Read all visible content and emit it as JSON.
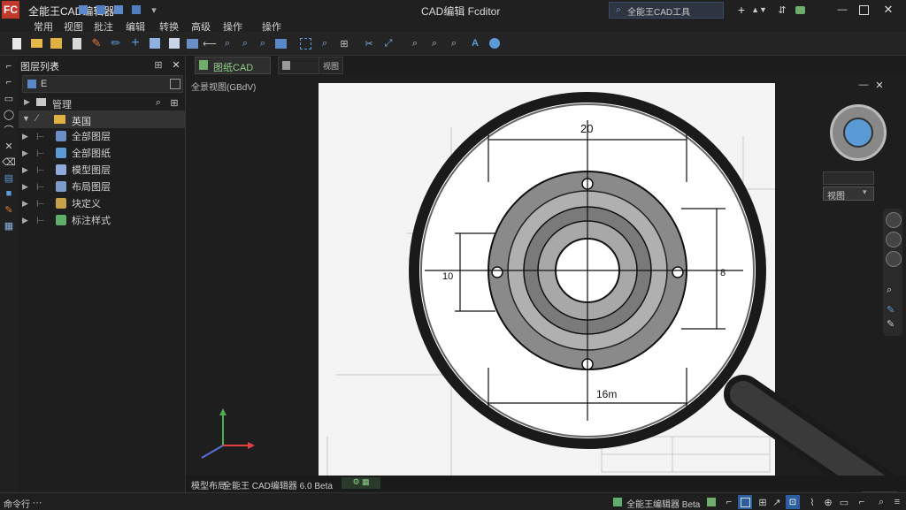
{
  "app": {
    "title": "全能王CAD编辑器",
    "window_title": "CAD编辑 Fcditor",
    "search_text": "全能王CAD工具",
    "colors": {
      "accent": "#4a90d9",
      "logo": "#c0392b",
      "bg": "#1c1c1c",
      "panel": "#262626"
    }
  },
  "menu": [
    "常用",
    "视图",
    "批注",
    "编辑",
    "转换",
    "高级",
    "操作"
  ],
  "left_panel": {
    "title": "图层列表",
    "search_value": "E",
    "section": "管理",
    "root": "英国",
    "items": [
      {
        "label": "全部图层",
        "color": "#6a8fc7"
      },
      {
        "label": "全部图纸",
        "color": "#5b9bd5"
      },
      {
        "label": "模型图层",
        "color": "#8fa9d8"
      },
      {
        "label": "布局图层",
        "color": "#7d9ccc"
      },
      {
        "label": "块定义",
        "color": "#c9a14a"
      },
      {
        "label": "标注样式",
        "color": "#5fae6a"
      }
    ]
  },
  "tabs": [
    {
      "label": "图纸CAD",
      "active": true
    },
    {
      "label": "",
      "active": false
    },
    {
      "label": "视图",
      "active": false
    }
  ],
  "view_label": "全景视图(GBdV)",
  "drawing": {
    "dim_top": "20",
    "dim_left": "10",
    "dim_right": "8",
    "dim_bottom": "16m"
  },
  "right_panel": {
    "dropdown1": "",
    "dropdown2": "视图"
  },
  "bottom_tabs": [
    "模型布局",
    "全能王 CAD编辑器 6.0 Beta"
  ],
  "status": {
    "left": "命令行",
    "right": "全能王编辑器 Beta"
  }
}
